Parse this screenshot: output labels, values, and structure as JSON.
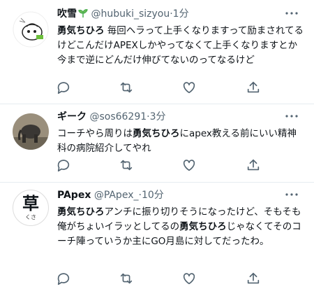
{
  "tweets": [
    {
      "name": "吹雪",
      "name_icon": "seedling-icon",
      "handle": "@hubuki_sizyou",
      "dot": "·",
      "time": "1分",
      "text_parts": [
        {
          "t": "勇気ちひろ",
          "b": true
        },
        {
          "t": " 毎回ヘラって上手くなりますって励まされてるけどこんだけAPEXしかやってなくて上手くなりますとか今まで逆にどんだけ伸びてないのってなるけど",
          "b": false
        }
      ]
    },
    {
      "name": "ギーク",
      "handle": "@sos66291",
      "dot": "·",
      "time": "3分",
      "text_parts": [
        {
          "t": "コーチやら周りは",
          "b": false
        },
        {
          "t": "勇気ちひろ",
          "b": true
        },
        {
          "t": "にapex教える前にいい精神科の病院紹介してやれ",
          "b": false
        }
      ]
    },
    {
      "name": "PApex",
      "handle": "@PApex_",
      "dot": "·",
      "time": "10分",
      "avatar_text": "草",
      "avatar_sub": "くさ",
      "text_parts": [
        {
          "t": "勇気ちひろ",
          "b": true
        },
        {
          "t": "アンチに振り切りそうになったけど、そもそも俺がちょいイラッとしてるの",
          "b": false
        },
        {
          "t": "勇気ちひろ",
          "b": true
        },
        {
          "t": "じゃなくてそのコーチ陣っていうか主にGO月島に対してだったわ。",
          "b": false
        }
      ]
    }
  ],
  "action_icons": [
    "reply-icon",
    "retweet-icon",
    "like-icon",
    "share-icon"
  ],
  "colors": {
    "secondary": "#536471",
    "separator": "#e6ecf0",
    "leaf": "#4caf50"
  }
}
